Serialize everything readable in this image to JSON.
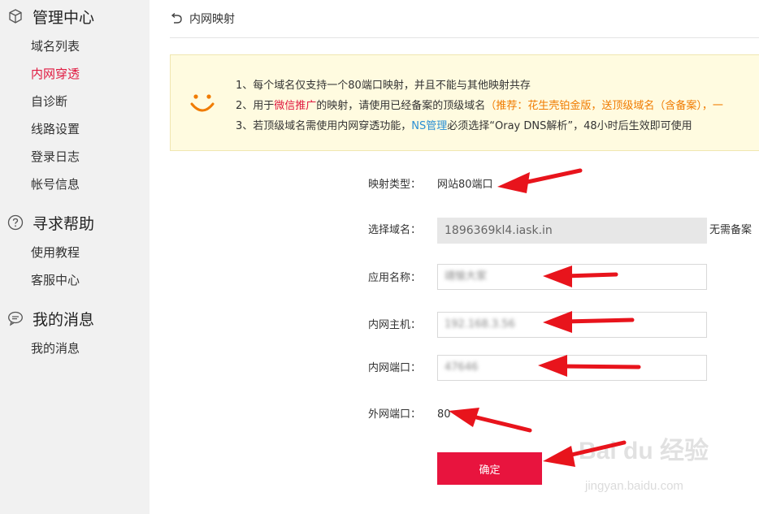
{
  "sidebar": {
    "groups": [
      {
        "title": "管理中心",
        "icon": "cube-icon",
        "items": [
          "域名列表",
          "内网穿透",
          "自诊断",
          "线路设置",
          "登录日志",
          "帐号信息"
        ]
      },
      {
        "title": "寻求帮助",
        "icon": "help-circle-icon",
        "items": [
          "使用教程",
          "客服中心"
        ]
      },
      {
        "title": "我的消息",
        "icon": "message-bubble-icon",
        "items": [
          "我的消息"
        ]
      }
    ],
    "active_item": "内网穿透"
  },
  "header": {
    "back_icon": "back-arrow-icon",
    "title": "内网映射"
  },
  "notice": {
    "icon": "smile-icon",
    "line1": "1、每个域名仅支持一个80端口映射，并且不能与其他映射共存",
    "line2_pre": "2、用于",
    "line2_red": "微信推广",
    "line2_mid": "的映射，请使用已经备案的顶级域名",
    "line2_orange": "（推荐：花生壳铂金版，送顶级域名（含备案），一",
    "line3_pre": "3、若顶级域名需使用内网穿透功能，",
    "line3_blue": "NS管理",
    "line3_post": "必须选择“Oray DNS解析”，48小时后生效即可使用"
  },
  "form": {
    "mapping_type": {
      "label": "映射类型：",
      "value": "网站80端口"
    },
    "domain": {
      "label": "选择域名：",
      "value": "1896369kl4.iask.in",
      "hint": "无需备案"
    },
    "app_name": {
      "label": "应用名称：",
      "value": "靖愉大家"
    },
    "host": {
      "label": "内网主机：",
      "value": "192.168.3.56"
    },
    "port": {
      "label": "内网端口：",
      "value": "47646"
    },
    "external_port": {
      "label": "外网端口：",
      "value": "80"
    },
    "confirm_label": "确定"
  },
  "watermark": {
    "text": "Bai du 经验",
    "sub": "jingyan.baidu.com"
  },
  "colors": {
    "accent": "#e8143e",
    "sidebar_bg": "#f1f1f1",
    "notice_bg": "#fffbe0",
    "link_blue": "#2a8fd4",
    "orange": "#f07b00"
  }
}
